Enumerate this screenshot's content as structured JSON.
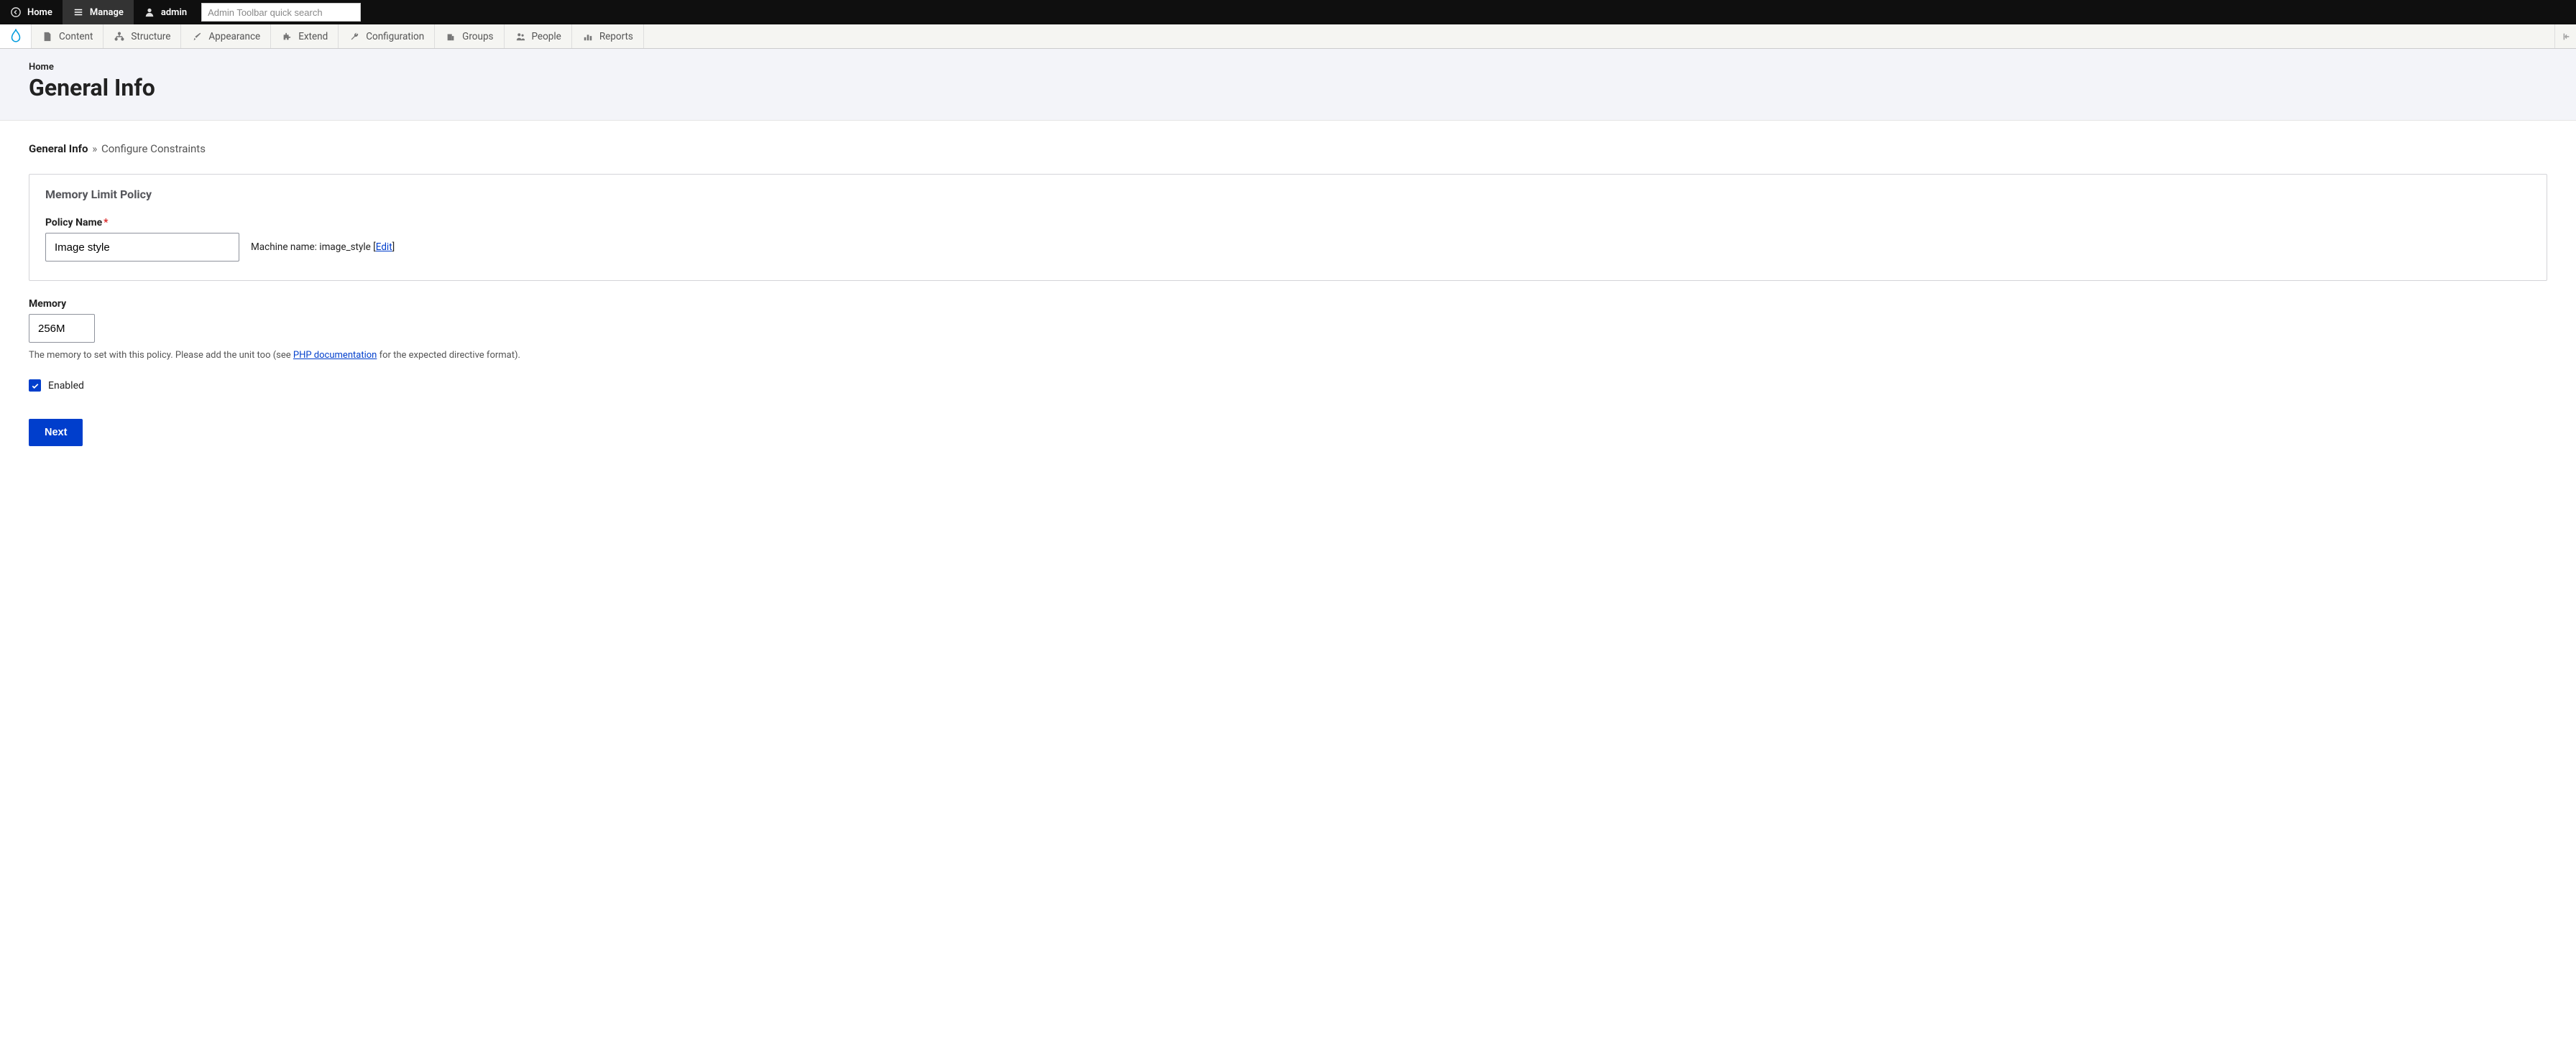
{
  "toolbar": {
    "home": "Home",
    "manage": "Manage",
    "user": "admin",
    "search_placeholder": "Admin Toolbar quick search"
  },
  "admin_menu": {
    "items": [
      {
        "label": "Content"
      },
      {
        "label": "Structure"
      },
      {
        "label": "Appearance"
      },
      {
        "label": "Extend"
      },
      {
        "label": "Configuration"
      },
      {
        "label": "Groups"
      },
      {
        "label": "People"
      },
      {
        "label": "Reports"
      }
    ]
  },
  "header": {
    "breadcrumb": "Home",
    "title": "General Info"
  },
  "wizard": {
    "current": "General Info",
    "separator": "»",
    "next": "Configure Constraints"
  },
  "fieldset": {
    "legend": "Memory Limit Policy",
    "policy_name_label": "Policy Name",
    "policy_name_value": "Image style",
    "machine_name_prefix": "Machine name: ",
    "machine_name_value": "image_style",
    "edit_label": "Edit"
  },
  "memory": {
    "label": "Memory",
    "value": "256M",
    "desc_pre": "The memory to set with this policy. Please add the unit too (see ",
    "desc_link": "PHP documentation",
    "desc_post": " for the expected directive format)."
  },
  "enabled": {
    "label": "Enabled",
    "checked": true
  },
  "actions": {
    "next": "Next"
  }
}
